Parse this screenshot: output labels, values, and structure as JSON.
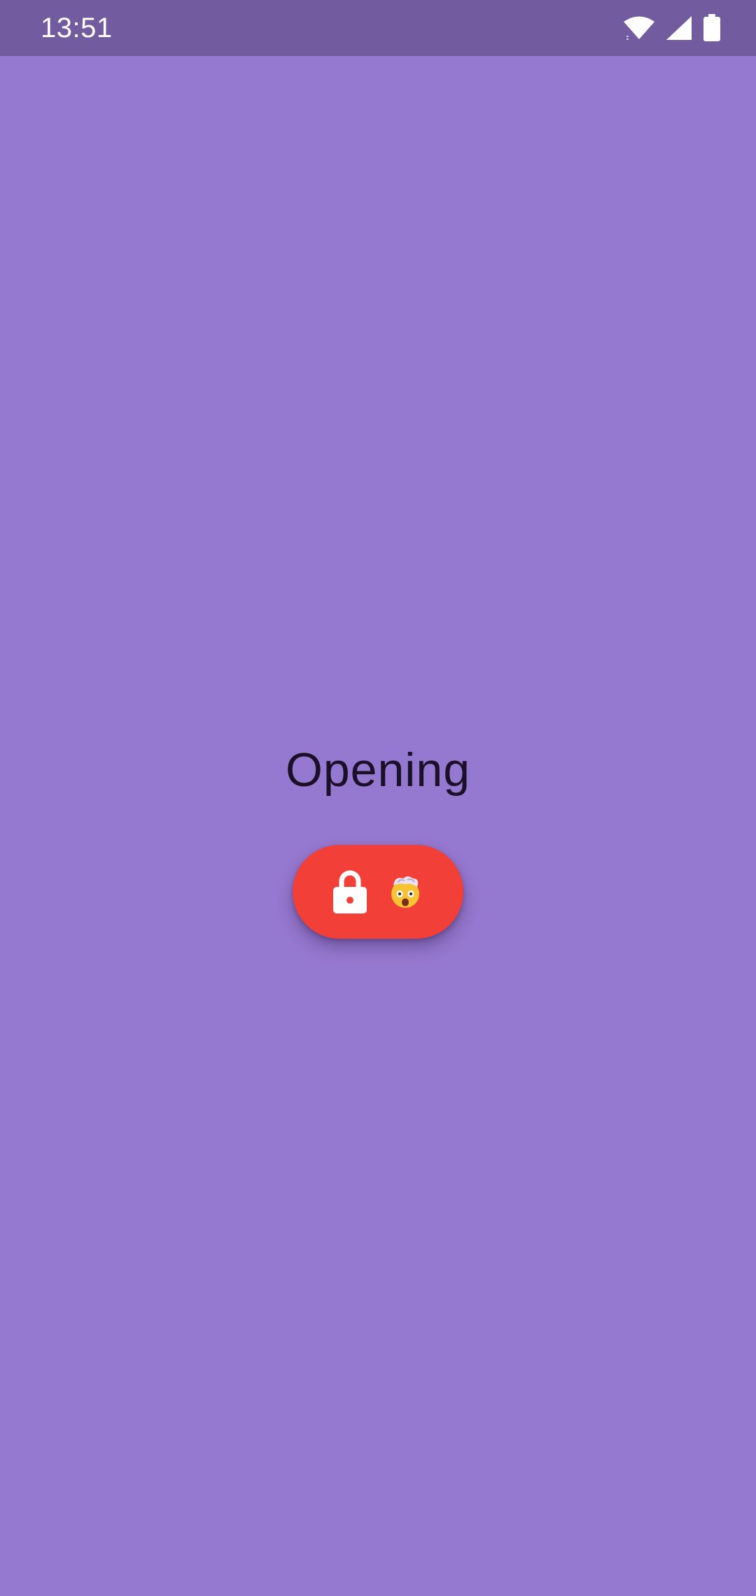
{
  "status_bar": {
    "time": "13:51",
    "icons": [
      "wifi-icon",
      "cellular-signal-icon",
      "battery-icon"
    ],
    "background": "#725b9e"
  },
  "screen": {
    "background": "#9578cf",
    "title": "Opening"
  },
  "action_button": {
    "color": "#f23f38",
    "icons": [
      "lock-icon",
      "exploding-head-emoji-icon"
    ]
  }
}
